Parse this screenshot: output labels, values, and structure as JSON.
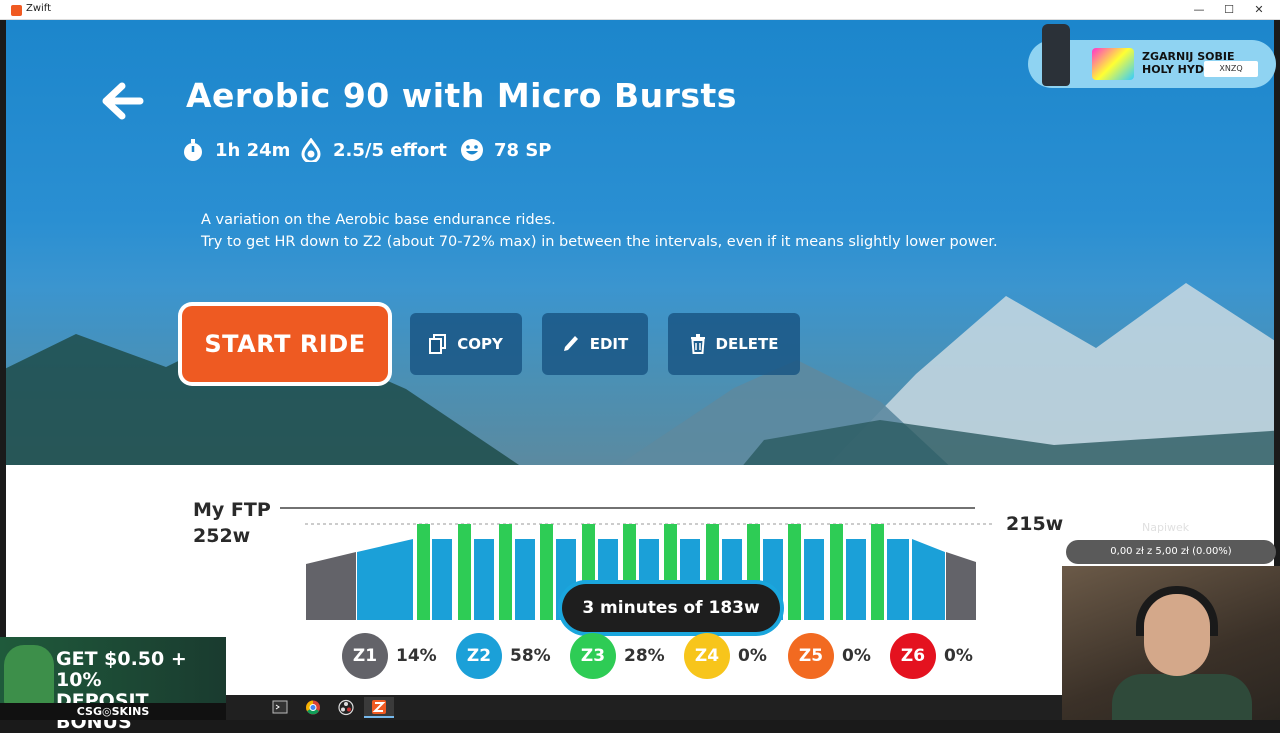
{
  "window": {
    "app_title": "Zwift",
    "controls": [
      "—",
      "☐",
      "✕"
    ]
  },
  "workout": {
    "title": "Aerobic 90 with Micro Bursts",
    "duration": "1h 24m",
    "effort": "2.5/5 effort",
    "sp": "78 SP",
    "description_line1": "A variation on the Aerobic base endurance rides.",
    "description_line2": "Try to get HR down to Z2 (about 70-72% max) in between the intervals, even if it means slightly lower power."
  },
  "actions": {
    "start": "START RIDE",
    "copy": "COPY",
    "edit": "EDIT",
    "delete": "DELETE"
  },
  "ftp": {
    "label": "My FTP",
    "value": "252w",
    "right_value": "215w"
  },
  "tooltip": "3 minutes of 183w",
  "zones": [
    {
      "name": "Z1",
      "pct": "14%",
      "color": "#636369"
    },
    {
      "name": "Z2",
      "pct": "58%",
      "color": "#1ba0d8"
    },
    {
      "name": "Z3",
      "pct": "28%",
      "color": "#2ecc55"
    },
    {
      "name": "Z4",
      "pct": "0%",
      "color": "#f7c51b"
    },
    {
      "name": "Z5",
      "pct": "0%",
      "color": "#f26a21"
    },
    {
      "name": "Z6",
      "pct": "0%",
      "color": "#e4121f"
    }
  ],
  "ad": {
    "headline": "ZGARNIJ SOBIE",
    "headline2": "HOLY HYDRATION",
    "code": "XNZQ"
  },
  "donation": {
    "title": "Napiwek",
    "progress": "0,00 zł z 5,00 zł (0.00%)"
  },
  "promo": {
    "line1": "GET $0.50 + 10%",
    "line2": "DEPOSIT BONUS",
    "brand": "CSG◎SKINS"
  },
  "colors": {
    "start_button": "#ee5a22",
    "secondary_button": "#185482",
    "z1_bar": "#636369",
    "z2_bar": "#1ba0d8",
    "z3_bar": "#2ecc55"
  }
}
